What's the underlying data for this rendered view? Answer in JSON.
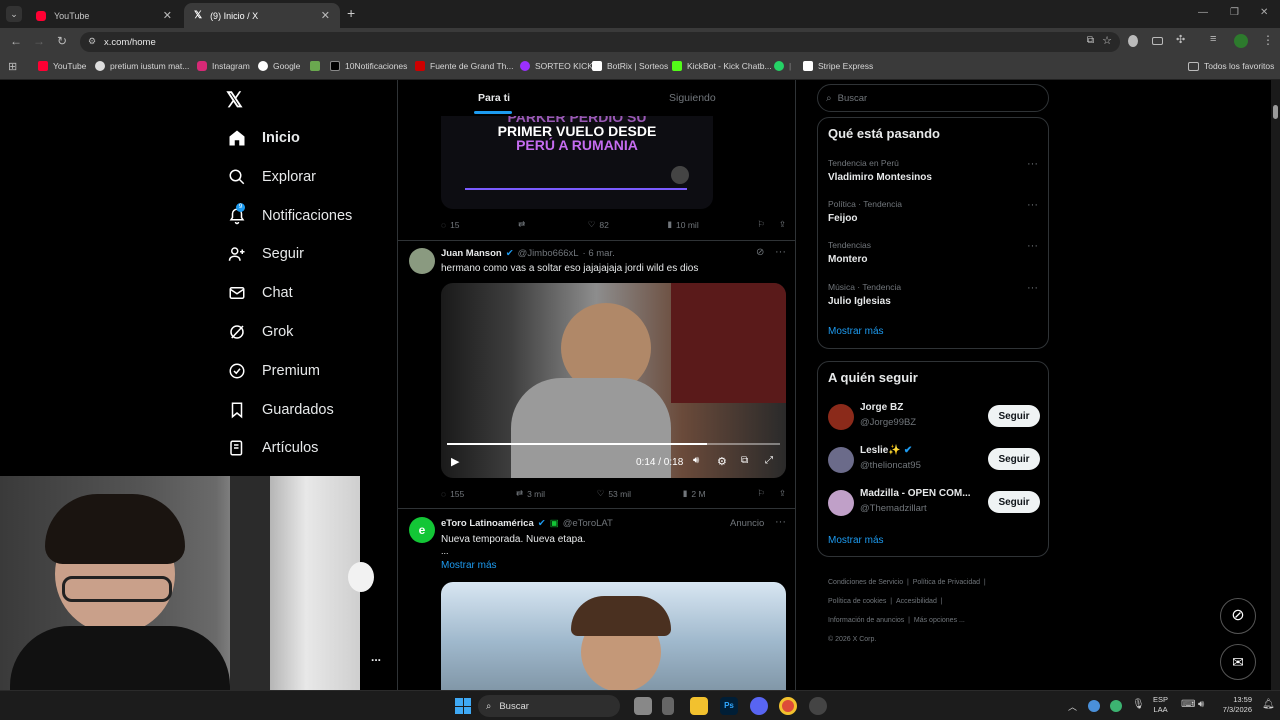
{
  "browser": {
    "tabs": [
      {
        "title": "YouTube",
        "active": false
      },
      {
        "title": "(9) Inicio / X",
        "active": true
      }
    ],
    "new_tab": "+",
    "url": "x.com/home",
    "bookmarks": [
      "YouTube",
      "pretium iustum mat...",
      "Instagram",
      "Google",
      "10Notificaciones",
      "Fuente de Grand Th...",
      "SORTEO KICK",
      "BotRix | Sorteos",
      "KickBot - Kick Chatb...",
      "Stripe Express"
    ],
    "all_bookmarks": "Todos los favoritos"
  },
  "sidebar": {
    "items": [
      {
        "label": "Inicio",
        "icon": "home-icon"
      },
      {
        "label": "Explorar",
        "icon": "search-icon"
      },
      {
        "label": "Notificaciones",
        "icon": "bell-icon",
        "badge": "9"
      },
      {
        "label": "Seguir",
        "icon": "add-person-icon"
      },
      {
        "label": "Chat",
        "icon": "mail-icon"
      },
      {
        "label": "Grok",
        "icon": "grok-icon"
      },
      {
        "label": "Premium",
        "icon": "verified-icon"
      },
      {
        "label": "Guardados",
        "icon": "bookmark-icon"
      },
      {
        "label": "Artículos",
        "icon": "article-icon"
      }
    ],
    "more": "..."
  },
  "feed": {
    "tabs": [
      "Para ti",
      "Siguiendo"
    ],
    "tweet1": {
      "media_text": [
        "PARKER PERDIÓ SU",
        "PRIMER VUELO DESDE",
        "PERÚ A RUMANIA"
      ],
      "replies": "15",
      "reposts": "",
      "likes": "82",
      "views": "10 mil"
    },
    "tweet2": {
      "name": "Juan Manson",
      "handle": "@Jimbo666xL",
      "date": "· 6 mar.",
      "text": "hermano como vas a soltar eso jajajajaja jordi wild es dios",
      "video_time": "0:14 / 0:18",
      "replies": "155",
      "reposts": "3 mil",
      "likes": "53 mil",
      "views": "2 M"
    },
    "tweet3": {
      "name": "eToro Latinoamérica",
      "handle": "@eToroLAT",
      "tag": "Anuncio",
      "text": "Nueva temporada. Nueva etapa.",
      "ellipsis": "...",
      "more": "Mostrar más"
    }
  },
  "right": {
    "search_placeholder": "Buscar",
    "trends_title": "Qué está pasando",
    "trends": [
      {
        "context": "Tendencia en Perú",
        "name": "Vladimiro Montesinos"
      },
      {
        "context": "Política · Tendencia",
        "name": "Feijoo"
      },
      {
        "context": "Tendencias",
        "name": "Montero"
      },
      {
        "context": "Música · Tendencia",
        "name": "Julio Iglesias"
      }
    ],
    "trends_more": "Mostrar más",
    "follow_title": "A quién seguir",
    "follow": [
      {
        "name": "Jorge BZ",
        "handle": "@Jorge99BZ",
        "button": "Seguir"
      },
      {
        "name": "Leslie✨",
        "handle": "@thelioncat95",
        "button": "Seguir"
      },
      {
        "name": "Madzilla - OPEN COM...",
        "handle": "@Themadzillart",
        "button": "Seguir"
      }
    ],
    "follow_more": "Mostrar más",
    "footer": [
      "Condiciones de Servicio",
      "Política de Privacidad",
      "Política de cookies",
      "Accesibilidad",
      "Información de anuncios",
      "Más opciones ...",
      "© 2026 X Corp."
    ]
  },
  "taskbar": {
    "search": "Buscar",
    "lang": "ESP",
    "lang2": "LAA",
    "time": "13:59",
    "date": "7/3/2026"
  },
  "colors": {
    "accent": "#1d9bf0",
    "bg": "#000000",
    "border": "#2f3336"
  }
}
